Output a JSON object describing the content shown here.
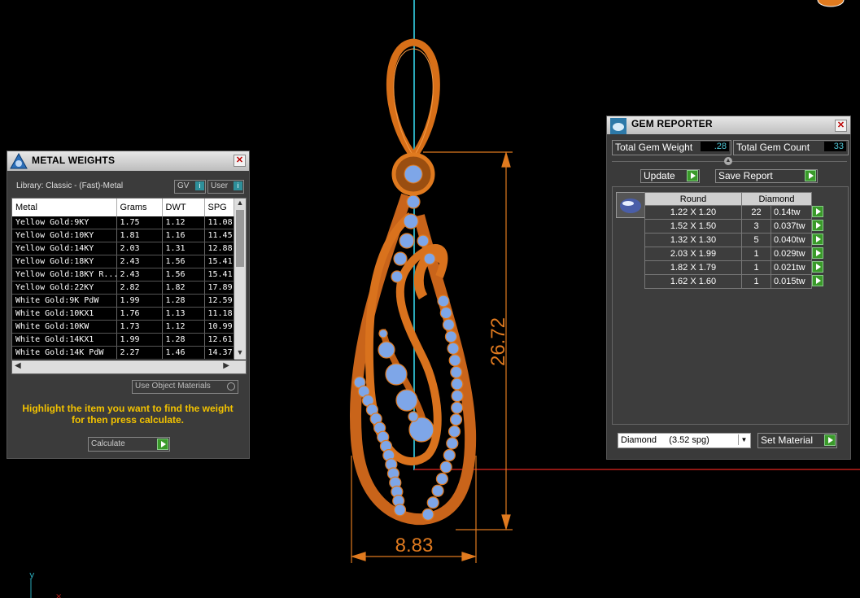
{
  "viewport": {
    "dimension_height": "26.72",
    "dimension_width": "8.83",
    "axis_y_label": "y",
    "accent_orange": "#e07a1f",
    "gem_blue": "#7ea6e8"
  },
  "metal_weights": {
    "title": "METAL WEIGHTS",
    "library_label": "Library: Classic - (Fast)-Metal",
    "gv_label": "GV",
    "user_label": "User",
    "columns": [
      "Metal",
      "Grams",
      "DWT",
      "SPG"
    ],
    "rows": [
      [
        "Yellow Gold:9KY",
        "1.75",
        "1.12",
        "11.08"
      ],
      [
        "Yellow Gold:10KY",
        "1.81",
        "1.16",
        "11.45"
      ],
      [
        "Yellow Gold:14KY",
        "2.03",
        "1.31",
        "12.88"
      ],
      [
        "Yellow Gold:18KY",
        "2.43",
        "1.56",
        "15.41"
      ],
      [
        "Yellow Gold:18KY R...",
        "2.43",
        "1.56",
        "15.41"
      ],
      [
        "Yellow Gold:22KY",
        "2.82",
        "1.82",
        "17.89"
      ],
      [
        "White Gold:9K PdW",
        "1.99",
        "1.28",
        "12.59"
      ],
      [
        "White Gold:10KX1",
        "1.76",
        "1.13",
        "11.18"
      ],
      [
        "White Gold:10KW",
        "1.73",
        "1.12",
        "10.99"
      ],
      [
        "White Gold:14KX1",
        "1.99",
        "1.28",
        "12.61"
      ],
      [
        "White Gold:14K PdW",
        "2.27",
        "1.46",
        "14.37"
      ]
    ],
    "use_object_materials": "Use Object Materials",
    "hint": "Highlight the item you want to find the weight for then press calculate.",
    "calculate_label": "Calculate"
  },
  "gem_reporter": {
    "title": "GEM REPORTER",
    "total_weight_label": "Total Gem Weight",
    "total_weight_value": ".28",
    "total_count_label": "Total Gem Count",
    "total_count_value": "33",
    "update_label": "Update",
    "save_report_label": "Save Report",
    "shape_header": "Round",
    "material_header": "Diamond",
    "rows": [
      [
        "1.22 X 1.20",
        "22",
        "0.14tw"
      ],
      [
        "1.52 X 1.50",
        "3",
        "0.037tw"
      ],
      [
        "1.32 X 1.30",
        "5",
        "0.040tw"
      ],
      [
        "2.03 X 1.99",
        "1",
        "0.029tw"
      ],
      [
        "1.82 X 1.79",
        "1",
        "0.021tw"
      ],
      [
        "1.62 X 1.60",
        "1",
        "0.015tw"
      ]
    ],
    "material_select": "Diamond     (3.52 spg)",
    "set_material_label": "Set Material"
  }
}
